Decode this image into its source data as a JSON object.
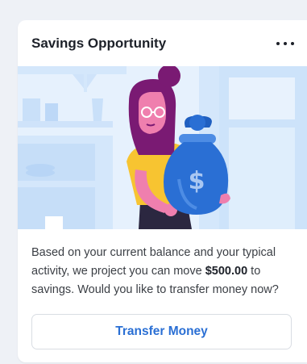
{
  "card": {
    "title": "Savings Opportunity",
    "menu_icon": "more-horizontal-icon",
    "illustration": "woman-holding-money-bag-illustration",
    "money_bag_symbol": "$",
    "body": {
      "text_before": "Based on your current balance and your typical activity, we project you can move ",
      "amount": "$500.00",
      "text_after": " to savings. Would you like to transfer money now?"
    },
    "button_label": "Transfer Money"
  },
  "colors": {
    "accent": "#2a6fd4",
    "illustration_bg": "#e6f1fd",
    "shirt": "#f7c431",
    "hair": "#7a1a73",
    "skin": "#ef7fae",
    "bag": "#2a6fd4"
  }
}
